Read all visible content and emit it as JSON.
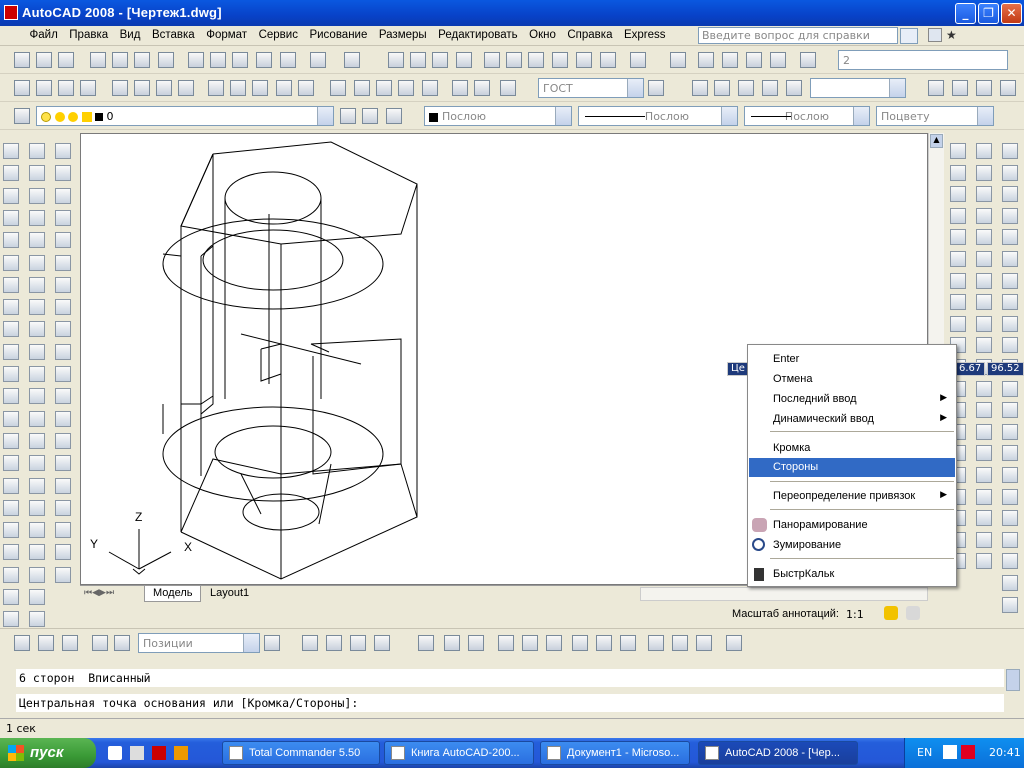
{
  "window": {
    "title": "AutoCAD 2008 - [Чертеж1.dwg]",
    "minimize": "_",
    "restore": "❐",
    "close": "✕"
  },
  "menu": {
    "items": [
      "Файл",
      "Правка",
      "Вид",
      "Вставка",
      "Формат",
      "Сервис",
      "Рисование",
      "Размеры",
      "Редактировать",
      "Окно",
      "Справка",
      "Express"
    ],
    "help_placeholder": "Введите вопрос для справки"
  },
  "toolbars": {
    "viewport_count": "2",
    "text_style": "ГОСТ",
    "layer": "0",
    "color": "Послою",
    "linetype": "Послою",
    "lineweight": "Послою",
    "plotstyle": "Поцвету",
    "positions": "Позиции"
  },
  "drawing": {
    "ucs": {
      "x": "X",
      "y": "Y",
      "z": "Z"
    },
    "tabs": [
      "Модель",
      "Layout1"
    ],
    "dyn_prompt": "Це",
    "dyn_value1": "6.67",
    "dyn_value2": "96.52"
  },
  "annotation": {
    "label": "Масштаб аннотаций:",
    "scale": "1:1"
  },
  "context_menu": {
    "items": [
      {
        "label": "Enter",
        "submenu": false
      },
      {
        "label": "Отмена",
        "submenu": false
      },
      {
        "label": "Последний ввод",
        "submenu": true
      },
      {
        "label": "Динамический ввод",
        "submenu": true
      },
      {
        "label": "Кромка",
        "submenu": false
      },
      {
        "label": "Стороны",
        "submenu": false,
        "selected": true
      },
      {
        "label": "Переопределение привязок",
        "submenu": true
      },
      {
        "label": "Панорамирование",
        "submenu": false
      },
      {
        "label": "Зумирование",
        "submenu": false
      },
      {
        "label": "БыстрКальк",
        "submenu": false
      }
    ]
  },
  "command": {
    "history": "6 сторон  Вписанный",
    "current": "Центральная точка основания или [Кромка/Стороны]:"
  },
  "statusbar": {
    "text": "1 сек"
  },
  "taskbar": {
    "start": "пуск",
    "buttons": [
      {
        "label": "Total Commander 5.50"
      },
      {
        "label": "Книга AutoCAD-200..."
      },
      {
        "label": "Документ1 - Microso..."
      },
      {
        "label": "AutoCAD 2008 - [Чер..."
      }
    ],
    "lang": "EN",
    "clock": "20:41"
  },
  "colors": {
    "selection": "#316ac5",
    "titlebar": "#0a58e0",
    "taskbar": "#245edb",
    "start": "#3a9a36"
  }
}
